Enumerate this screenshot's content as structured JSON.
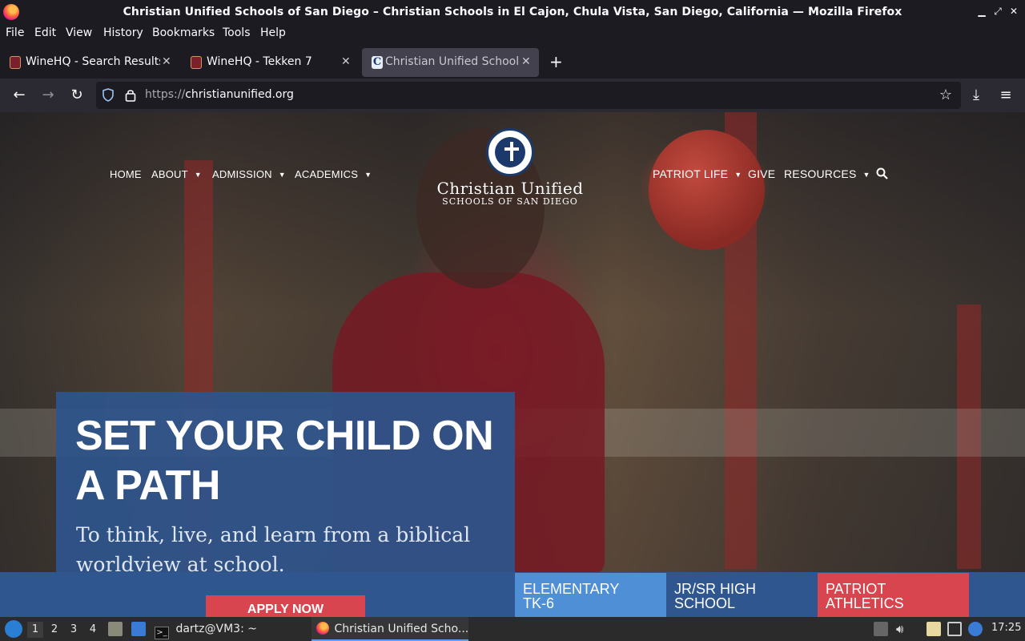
{
  "window": {
    "title": "Christian Unified Schools of San Diego – Christian Schools in El Cajon, Chula Vista, San Diego, California — Mozilla Firefox"
  },
  "menu": [
    "File",
    "Edit",
    "View",
    "History",
    "Bookmarks",
    "Tools",
    "Help"
  ],
  "tabs": [
    {
      "label": "WineHQ - Search Results",
      "favicon": "winehq-icon"
    },
    {
      "label": "WineHQ - Tekken 7",
      "favicon": "winehq-icon"
    },
    {
      "label": "Christian Unified Schools",
      "favicon": "cus-icon",
      "favicon_letter": "C",
      "active": true
    }
  ],
  "urlbar": {
    "scheme": "https://",
    "host": "christianunified.org"
  },
  "site": {
    "nav_left": [
      "HOME",
      "ABOUT",
      "ADMISSION",
      "ACADEMICS"
    ],
    "nav_right": [
      "PATRIOT LIFE",
      "GIVE",
      "RESOURCES"
    ],
    "logo_name": "Christian Unified",
    "logo_sub": "SCHOOLS OF SAN DIEGO",
    "hero_title": "SET YOUR CHILD ON A PATH",
    "hero_subtitle": "To think, live, and learn from a biblical worldview at school.",
    "apply_label": "APPLY NOW",
    "levels": [
      {
        "line1": "ELEMENTARY",
        "line2": "TK-6"
      },
      {
        "line1": "JR/SR HIGH",
        "line2": "SCHOOL"
      },
      {
        "line1": "PATRIOT",
        "line2": "ATHLETICS"
      }
    ]
  },
  "taskbar": {
    "workspaces": [
      "1",
      "2",
      "3",
      "4"
    ],
    "terminal_task": "dartz@VM3: ~",
    "browser_task": "Christian Unified Scho...",
    "clock": "17:25"
  },
  "colors": {
    "hero_blue": "#2e548c",
    "apply_red": "#d9454f",
    "elementary_blue": "#4f8fd6"
  }
}
